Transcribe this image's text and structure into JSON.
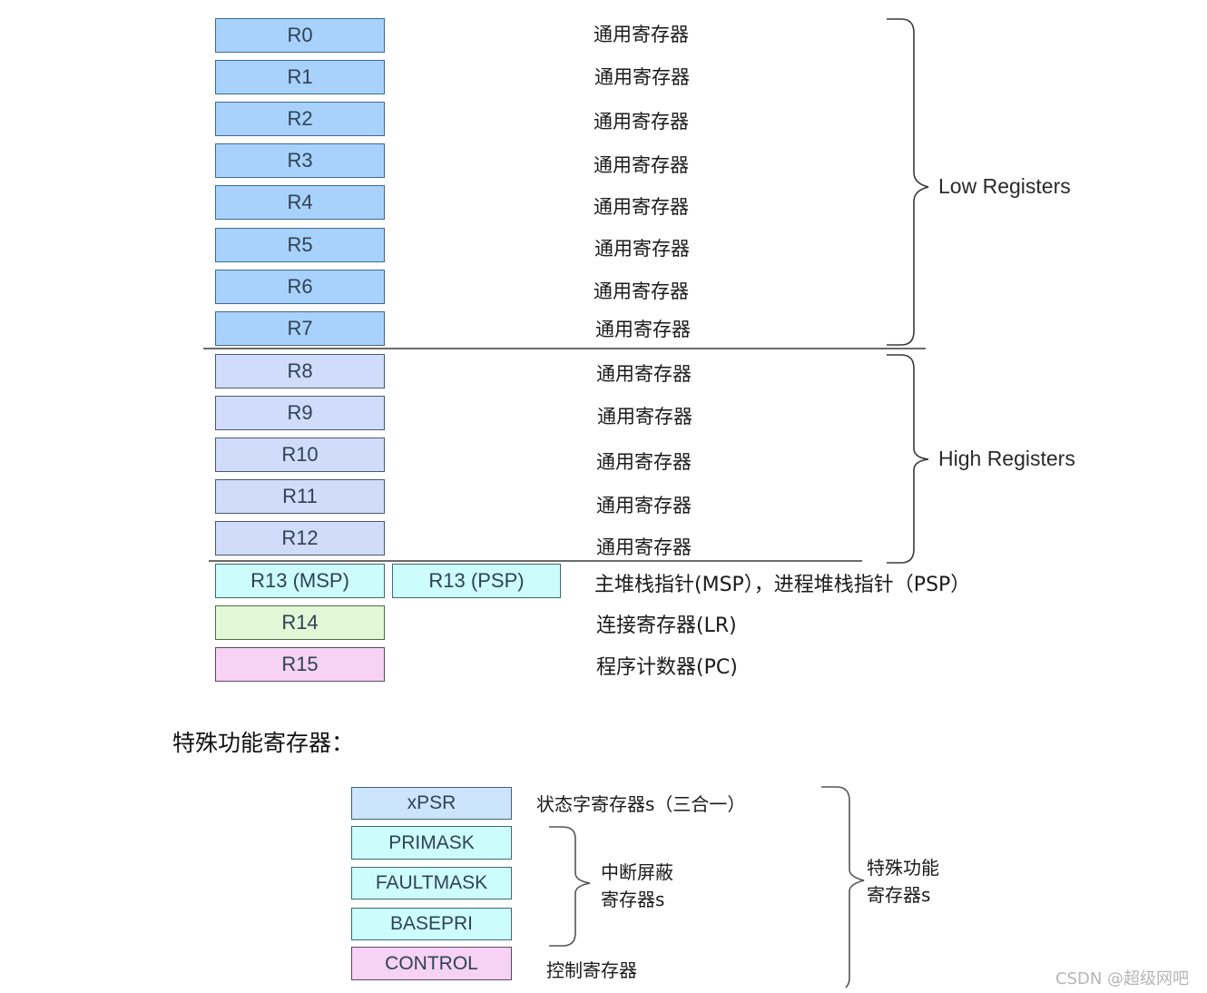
{
  "core_registers": [
    {
      "name": "R0",
      "desc": "通用寄存器",
      "group": "low"
    },
    {
      "name": "R1",
      "desc": "通用寄存器",
      "group": "low"
    },
    {
      "name": "R2",
      "desc": "通用寄存器",
      "group": "low"
    },
    {
      "name": "R3",
      "desc": "通用寄存器",
      "group": "low"
    },
    {
      "name": "R4",
      "desc": "通用寄存器",
      "group": "low"
    },
    {
      "name": "R5",
      "desc": "通用寄存器",
      "group": "low"
    },
    {
      "name": "R6",
      "desc": "通用寄存器",
      "group": "low"
    },
    {
      "name": "R7",
      "desc": "通用寄存器",
      "group": "low"
    },
    {
      "name": "R8",
      "desc": "通用寄存器",
      "group": "high"
    },
    {
      "name": "R9",
      "desc": "通用寄存器",
      "group": "high"
    },
    {
      "name": "R10",
      "desc": "通用寄存器",
      "group": "high"
    },
    {
      "name": "R11",
      "desc": "通用寄存器",
      "group": "high"
    },
    {
      "name": "R12",
      "desc": "通用寄存器",
      "group": "high"
    }
  ],
  "stack_pointers": {
    "msp": "R13 (MSP)",
    "psp": "R13 (PSP)",
    "desc": "主堆栈指针(MSP），进程堆栈指针（PSP）"
  },
  "link_register": {
    "name": "R14",
    "desc": "连接寄存器(LR)"
  },
  "program_counter": {
    "name": "R15",
    "desc": "程序计数器(PC)"
  },
  "groups": {
    "low_label": "Low Registers",
    "high_label": "High Registers"
  },
  "special": {
    "title": "特殊功能寄存器：",
    "xpsr": {
      "name": "xPSR",
      "desc": "状态字寄存器s（三合一）"
    },
    "masks": [
      "PRIMASK",
      "FAULTMASK",
      "BASEPRI"
    ],
    "mask_label_line1": "中断屏蔽",
    "mask_label_line2": "寄存器s",
    "control": {
      "name": "CONTROL",
      "desc": "控制寄存器"
    },
    "group_label_line1": "特殊功能",
    "group_label_line2": "寄存器s"
  },
  "colors": {
    "low": "#a8d2fb",
    "high": "#d1dcfb",
    "stack": "#ccfcfb",
    "lr": "#e1f7d6",
    "pc": "#f6d2f5",
    "xpsr": "#cde5fc"
  },
  "watermark": "CSDN @超级网吧"
}
